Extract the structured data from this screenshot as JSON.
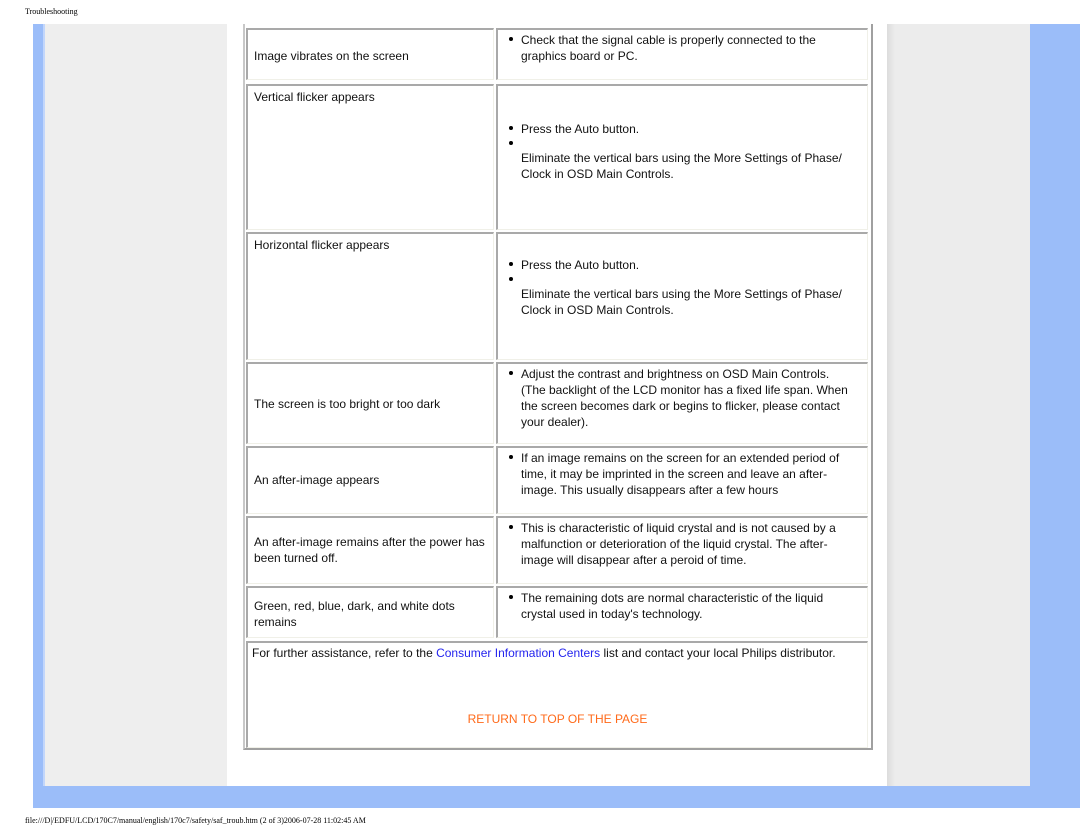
{
  "page": {
    "header_title": "Troubleshooting",
    "footer_path": "file:///D|/EDFU/LCD/170C7/manual/english/170c7/safety/saf_troub.htm (2 of 3)2006-07-28 11:02:45 AM"
  },
  "rows": [
    {
      "problem": "Image vibrates on the screen",
      "solutions": [
        "Check that the signal cable is properly connected to the graphics board or PC."
      ]
    },
    {
      "problem": "Vertical flicker appears",
      "solutions": [
        "Press the Auto button.",
        "Eliminate the vertical bars using the More Settings of Phase/ Clock in OSD Main Controls."
      ]
    },
    {
      "problem": "Horizontal flicker appears",
      "solutions": [
        "Press the Auto button.",
        "Eliminate the vertical bars using the More Settings of Phase/ Clock in OSD Main Controls."
      ]
    },
    {
      "problem": "The screen is too bright or too dark",
      "solutions": [
        "Adjust the contrast and brightness on OSD Main Controls. (The backlight of the LCD monitor has a fixed life span. When the screen becomes dark or begins to flicker, please contact your dealer)."
      ]
    },
    {
      "problem": "An after-image appears",
      "solutions": [
        "If an image remains on the screen for an extended period of time, it may be imprinted in the screen and leave an after-image. This usually disappears after a few hours"
      ]
    },
    {
      "problem": "An after-image remains after the power has been turned off.",
      "solutions": [
        "This is characteristic of liquid crystal and is not caused by a malfunction or deterioration of the liquid crystal. The after-image will disappear after a peroid of time."
      ]
    },
    {
      "problem": "Green, red, blue, dark, and white dots remains",
      "solutions": [
        "The remaining dots are normal characteristic of the liquid crystal used in today's technology."
      ]
    }
  ],
  "assistance": {
    "prefix": "For further assistance, refer to the ",
    "link_label": "Consumer Information Centers",
    "suffix": " list and contact your local Philips distributor."
  },
  "return_link": "RETURN TO TOP OF THE PAGE",
  "colors": {
    "frame_blue": "#9bbdf9",
    "sidebar_gray": "#eeeeee",
    "link_blue": "#2424ee",
    "return_orange": "#ff6a1a"
  }
}
